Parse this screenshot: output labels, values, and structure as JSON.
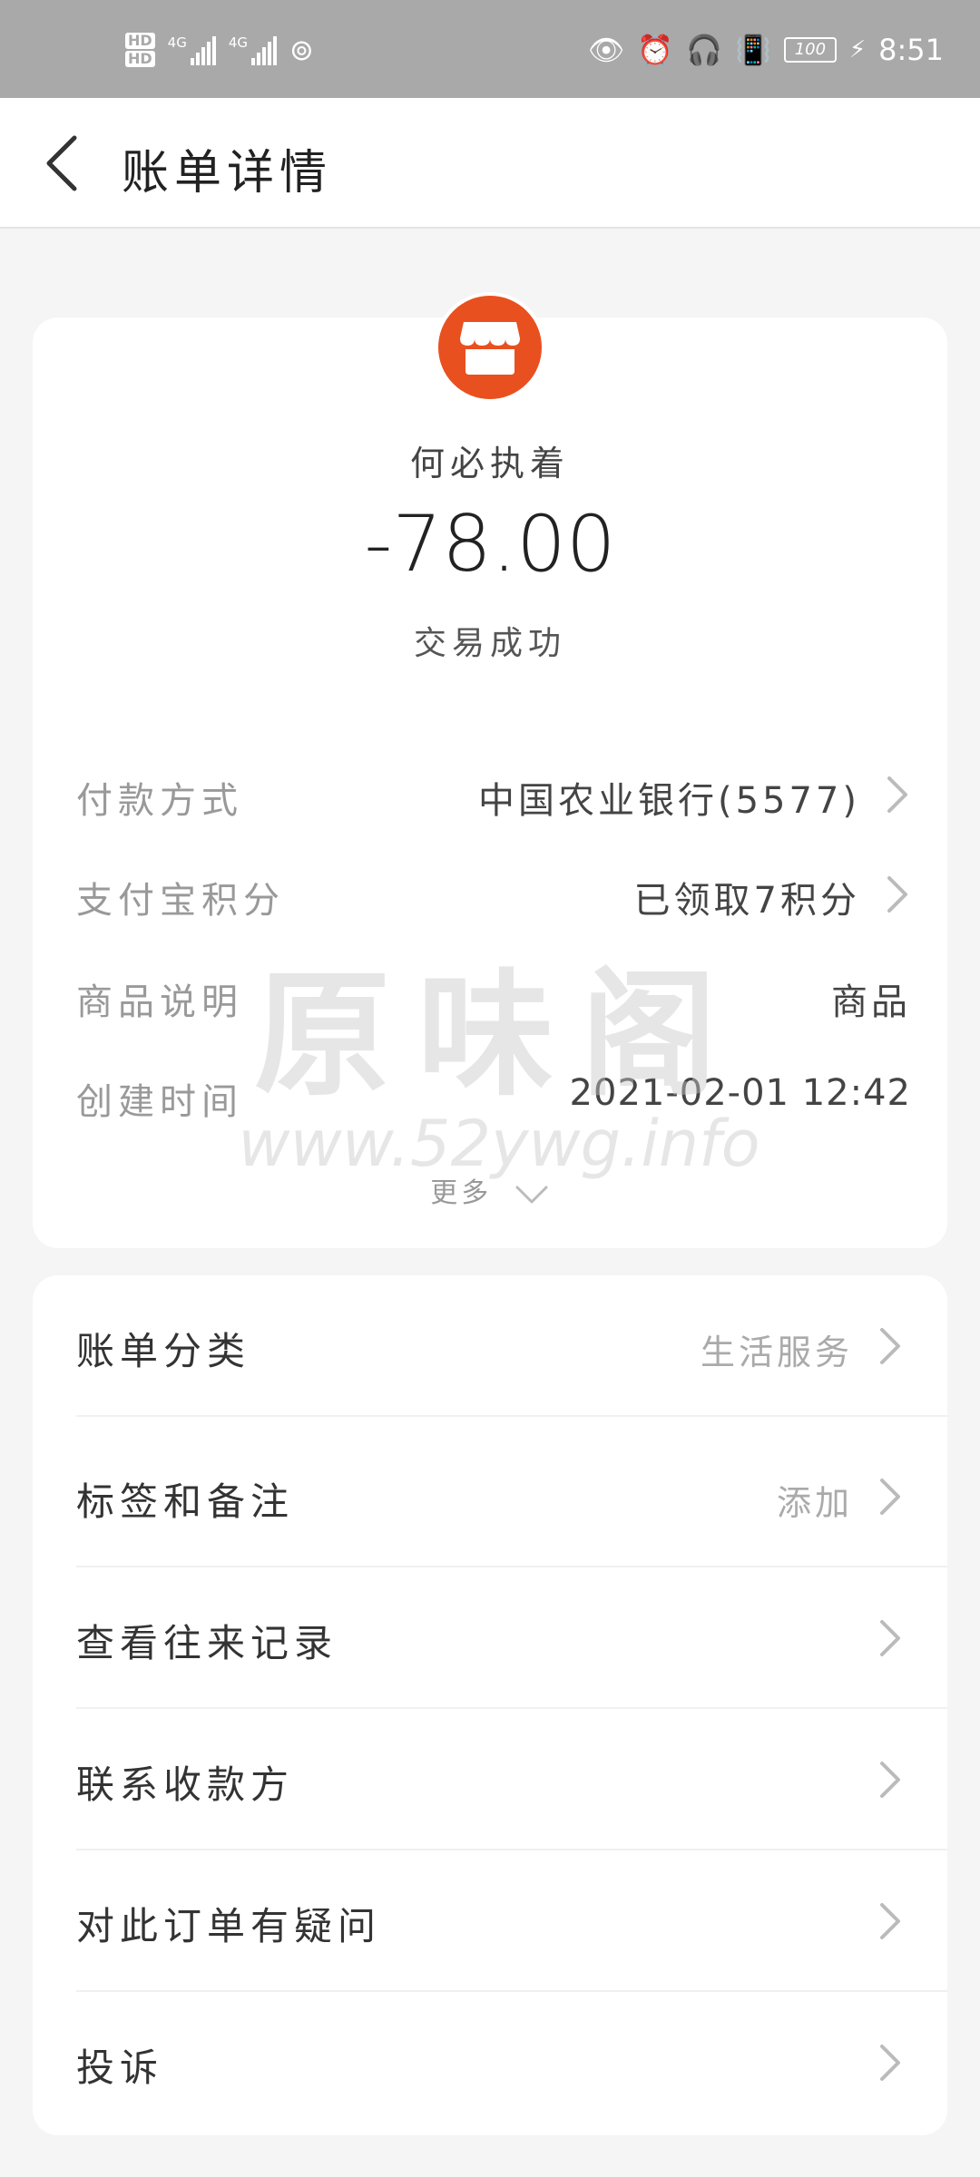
{
  "statusbar": {
    "hd1": "HD",
    "hd2": "HD",
    "net1": "4G",
    "net2": "4G",
    "battery": "100",
    "time": "8:51"
  },
  "nav": {
    "title": "账单详情"
  },
  "bill": {
    "merchant": "何必执着",
    "amount": "-78.00",
    "status": "交易成功",
    "details": [
      {
        "key": "付款方式",
        "value": "中国农业银行(5577)"
      },
      {
        "key": "支付宝积分",
        "value": "已领取7积分"
      },
      {
        "key": "商品说明",
        "value": "商品"
      },
      {
        "key": "创建时间",
        "value": "2021-02-01  12:42"
      }
    ],
    "more": "更多"
  },
  "watermark": {
    "text": "原味阁",
    "url": "www.52ywg.info"
  },
  "actions": [
    {
      "label": "账单分类",
      "value": "生活服务"
    },
    {
      "label": "标签和备注",
      "value": "添加"
    },
    {
      "label": "查看往来记录",
      "value": ""
    },
    {
      "label": "联系收款方",
      "value": ""
    },
    {
      "label": "对此订单有疑问",
      "value": ""
    },
    {
      "label": "投诉",
      "value": ""
    }
  ],
  "colors": {
    "accent": "#e9501f",
    "statusbar": "#a9a9a9"
  }
}
